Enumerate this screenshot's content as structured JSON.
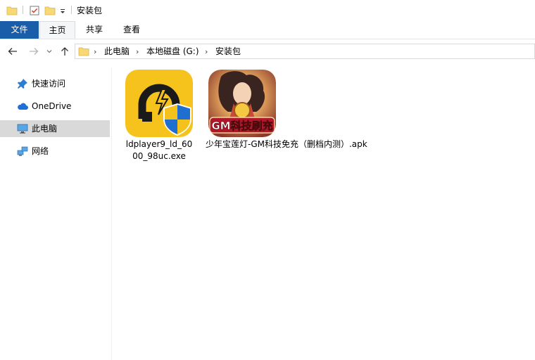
{
  "window": {
    "title": "安装包"
  },
  "ribbon": {
    "tabs": [
      "文件",
      "主页",
      "共享",
      "查看"
    ]
  },
  "nav": {
    "breadcrumbs": [
      "此电脑",
      "本地磁盘 (G:)",
      "安装包"
    ]
  },
  "sidebar": {
    "items": [
      {
        "label": "快速访问",
        "icon": "pin-icon"
      },
      {
        "label": "OneDrive",
        "icon": "cloud-icon"
      },
      {
        "label": "此电脑",
        "icon": "computer-icon",
        "selected": true
      },
      {
        "label": "网络",
        "icon": "network-icon"
      }
    ]
  },
  "files": [
    {
      "name_line1": "ldplayer9_ld_60",
      "name_line2": "00_98uc.exe",
      "icon": "ldplayer-app-icon"
    },
    {
      "name": "少年宝莲灯-GM科技免充（删档内测）.apk",
      "icon": "game-apk-icon",
      "badge": "GM科技刷充"
    }
  ],
  "colors": {
    "file_tab": "#1a5ea9",
    "selected_row": "#d9d9d9",
    "folder": "#f8d775",
    "ld_yellow": "#f6c21c"
  }
}
